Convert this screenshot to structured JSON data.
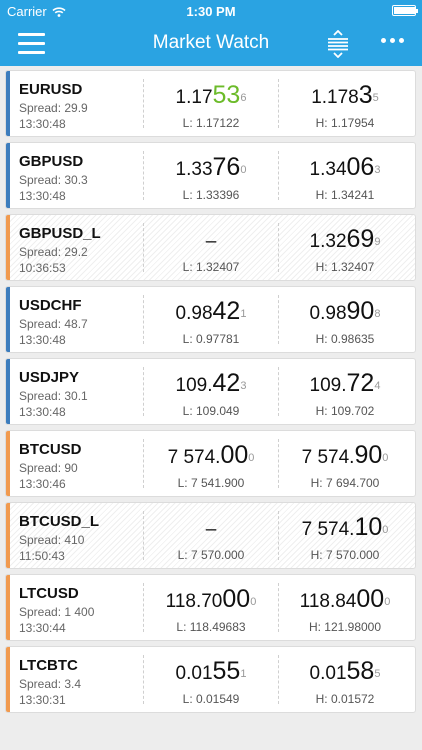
{
  "status_bar": {
    "carrier": "Carrier",
    "time": "1:30 PM",
    "battery_level": 1.0
  },
  "header": {
    "title": "Market Watch",
    "menu_icon": "hamburger-icon",
    "sort_icon": "sort-icon",
    "more_icon": "more-icon"
  },
  "colors": {
    "header_bg": "#2aa3e2",
    "accent_blue": "#3d7dbd",
    "accent_orange": "#f19a4f",
    "price_up": "#6cbb2a"
  },
  "rows": [
    {
      "symbol": "EURUSD",
      "spread": "Spread: 29.9",
      "time": "13:30:48",
      "accent": "blue",
      "disabled": false,
      "bid": {
        "pre": "1.17",
        "big": "53",
        "sup": "6",
        "dash": ""
      },
      "bid_color": "green",
      "low": "L: 1.17122",
      "ask": {
        "pre": "1.178",
        "big": "3",
        "sup": "5"
      },
      "high": "H: 1.17954"
    },
    {
      "symbol": "GBPUSD",
      "spread": "Spread: 30.3",
      "time": "13:30:48",
      "accent": "blue",
      "disabled": false,
      "bid": {
        "pre": "1.33",
        "big": "76",
        "sup": "0",
        "dash": ""
      },
      "bid_color": "",
      "low": "L: 1.33396",
      "ask": {
        "pre": "1.34",
        "big": "06",
        "sup": "3"
      },
      "high": "H: 1.34241"
    },
    {
      "symbol": "GBPUSD_L",
      "spread": "Spread: 29.2",
      "time": "10:36:53",
      "accent": "orange",
      "disabled": true,
      "bid": {
        "pre": "",
        "big": "",
        "sup": "",
        "dash": "–"
      },
      "bid_color": "",
      "low": "L: 1.32407",
      "ask": {
        "pre": "1.32",
        "big": "69",
        "sup": "9"
      },
      "high": "H: 1.32407"
    },
    {
      "symbol": "USDCHF",
      "spread": "Spread: 48.7",
      "time": "13:30:48",
      "accent": "blue",
      "disabled": false,
      "bid": {
        "pre": "0.98",
        "big": "42",
        "sup": "1",
        "dash": ""
      },
      "bid_color": "",
      "low": "L: 0.97781",
      "ask": {
        "pre": "0.98",
        "big": "90",
        "sup": "8"
      },
      "high": "H: 0.98635"
    },
    {
      "symbol": "USDJPY",
      "spread": "Spread: 30.1",
      "time": "13:30:48",
      "accent": "blue",
      "disabled": false,
      "bid": {
        "pre": "109.",
        "big": "42",
        "sup": "3",
        "dash": ""
      },
      "bid_color": "",
      "low": "L: 109.049",
      "ask": {
        "pre": "109.",
        "big": "72",
        "sup": "4"
      },
      "high": "H: 109.702"
    },
    {
      "symbol": "BTCUSD",
      "spread": "Spread: 90",
      "time": "13:30:46",
      "accent": "orange",
      "disabled": false,
      "bid": {
        "pre": "7 574.",
        "big": "00",
        "sup": "0",
        "dash": ""
      },
      "bid_color": "",
      "low": "L: 7 541.900",
      "ask": {
        "pre": "7 574.",
        "big": "90",
        "sup": "0"
      },
      "high": "H: 7 694.700"
    },
    {
      "symbol": "BTCUSD_L",
      "spread": "Spread: 410",
      "time": "11:50:43",
      "accent": "orange",
      "disabled": true,
      "bid": {
        "pre": "",
        "big": "",
        "sup": "",
        "dash": "–"
      },
      "bid_color": "",
      "low": "L: 7 570.000",
      "ask": {
        "pre": "7 574.",
        "big": "10",
        "sup": "0"
      },
      "high": "H: 7 570.000"
    },
    {
      "symbol": "LTCUSD",
      "spread": "Spread: 1 400",
      "time": "13:30:44",
      "accent": "orange",
      "disabled": false,
      "bid": {
        "pre": "118.70",
        "big": "00",
        "sup": "0",
        "dash": ""
      },
      "bid_color": "",
      "low": "L: 118.49683",
      "ask": {
        "pre": "118.84",
        "big": "00",
        "sup": "0"
      },
      "high": "H: 121.98000"
    },
    {
      "symbol": "LTCBTC",
      "spread": "Spread: 3.4",
      "time": "13:30:31",
      "accent": "orange",
      "disabled": false,
      "bid": {
        "pre": "0.01",
        "big": "55",
        "sup": "1",
        "dash": ""
      },
      "bid_color": "",
      "low": "L: 0.01549",
      "ask": {
        "pre": "0.01",
        "big": "58",
        "sup": "5"
      },
      "high": "H: 0.01572"
    }
  ]
}
